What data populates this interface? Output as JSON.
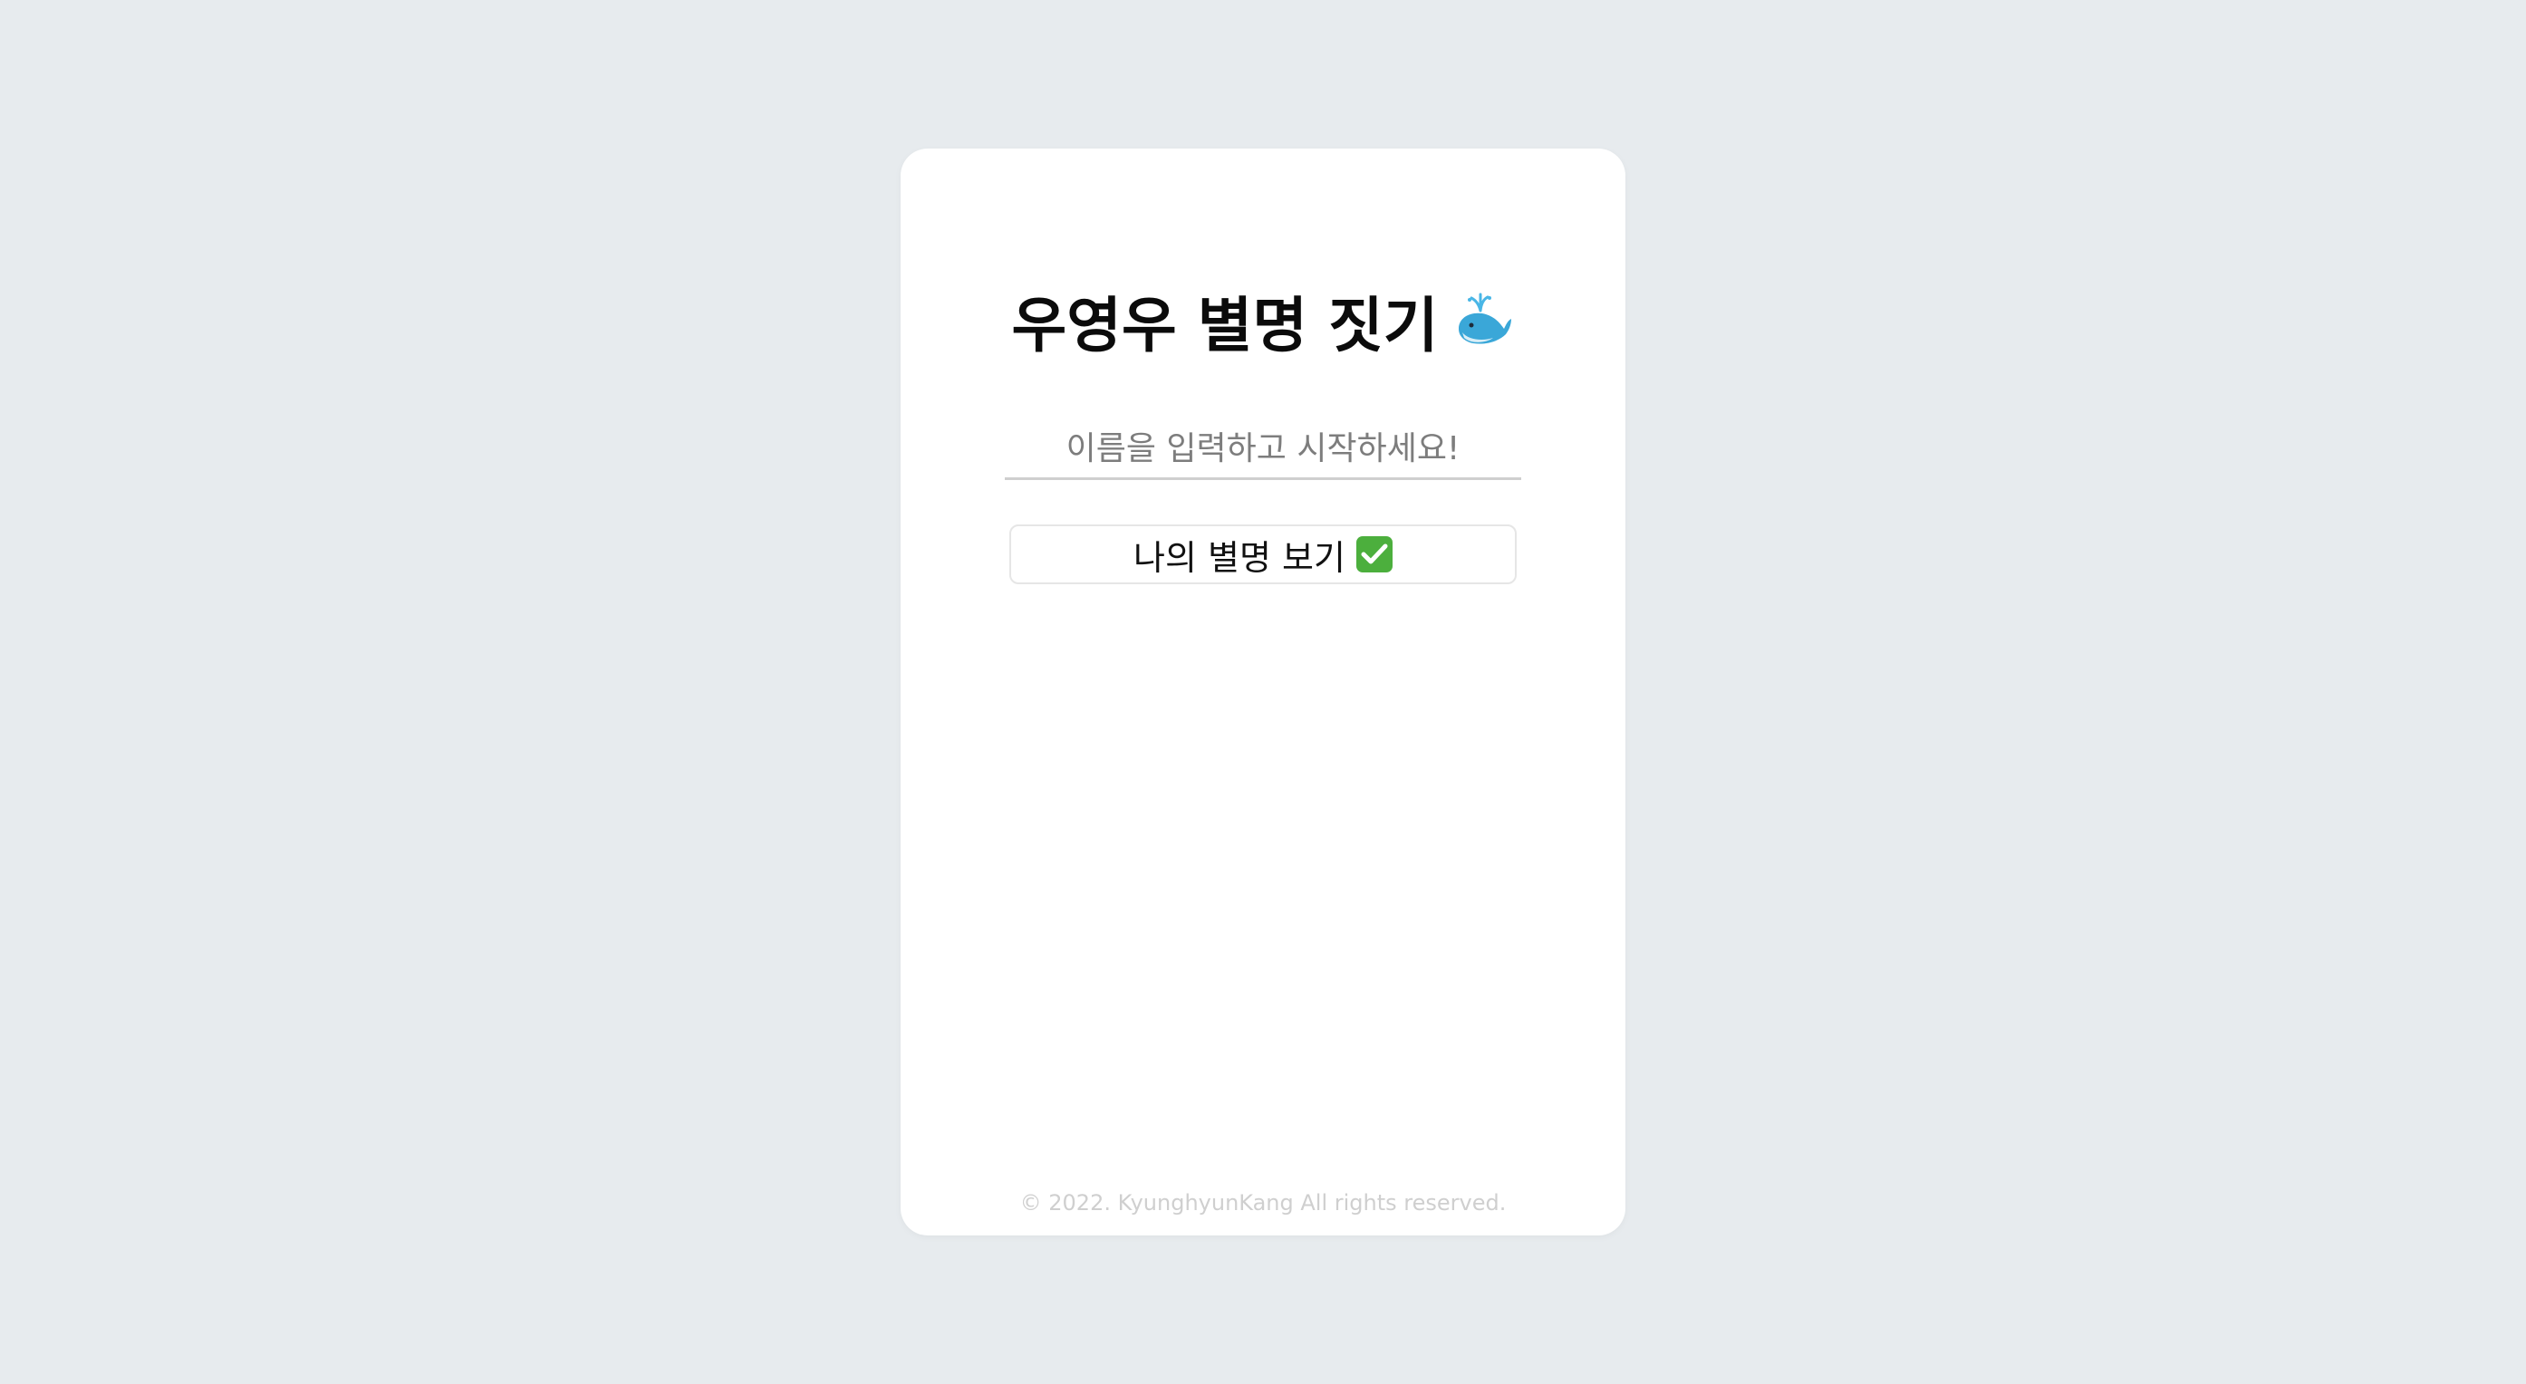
{
  "app": {
    "title": "우영우 별명 짓기",
    "title_icon": "whale-icon"
  },
  "form": {
    "name_placeholder": "이름을 입력하고 시작하세요!",
    "name_value": "",
    "submit_label": "나의 별명 보기",
    "submit_icon": "check-mark-icon"
  },
  "footer": {
    "copyright": "© 2022. KyunghyunKang All rights reserved."
  },
  "colors": {
    "background": "#e7ebee",
    "card": "#ffffff",
    "check_icon": "#4caf3d",
    "whale_icon": "#3aa7d8"
  }
}
